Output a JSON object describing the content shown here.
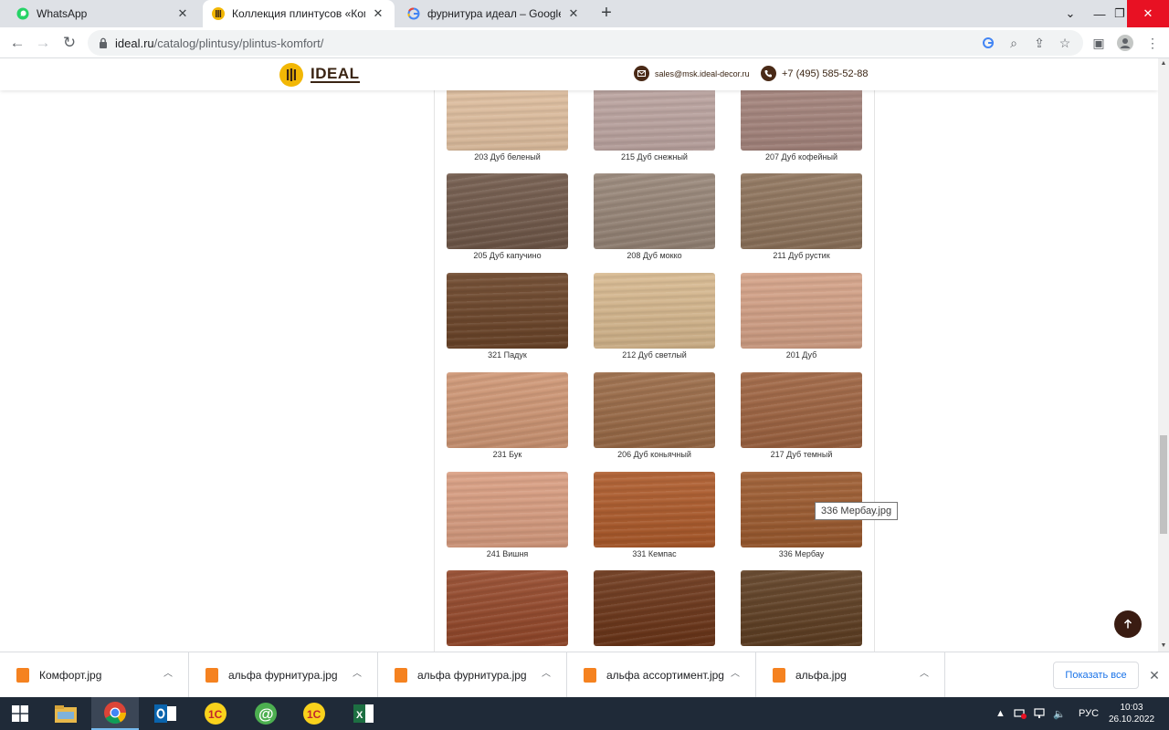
{
  "browser": {
    "tabs": [
      {
        "title": "WhatsApp",
        "icon": "whatsapp-icon",
        "active": false
      },
      {
        "title": "Коллекция плинтусов «Комфорт»",
        "icon": "ideal-logo-icon",
        "active": true
      },
      {
        "title": "фурнитура идеал – Google Поиск",
        "icon": "google-icon",
        "active": false
      }
    ],
    "new_tab_label": "+",
    "url_host": "ideal.ru",
    "url_path": "/catalog/plintusy/plintus-komfort/"
  },
  "site": {
    "brand": "IDEAL",
    "email": "sales@msk.ideal-decor.ru",
    "phone": "+7 (495) 585-52-88"
  },
  "swatches": [
    {
      "label": "203 Дуб беленый",
      "color": "#e4c3a3"
    },
    {
      "label": "215 Дуб снежный",
      "color": "#c0a8a4"
    },
    {
      "label": "207 Дуб кофейный",
      "color": "#a8877f"
    },
    {
      "label": "205 Дуб капучино",
      "color": "#705849"
    },
    {
      "label": "208 Дуб мокко",
      "color": "#978577"
    },
    {
      "label": "211 Дуб рустик",
      "color": "#8e735b"
    },
    {
      "label": "321 Падук",
      "color": "#6b4428"
    },
    {
      "label": "212 Дуб светлый",
      "color": "#d7b88e"
    },
    {
      "label": "201 Дуб",
      "color": "#d4a186"
    },
    {
      "label": "231 Бук",
      "color": "#cf9674"
    },
    {
      "label": "206 Дуб коньячный",
      "color": "#9a6a46"
    },
    {
      "label": "217 Дуб темный",
      "color": "#9e6340"
    },
    {
      "label": "241 Вишня",
      "color": "#d99d80"
    },
    {
      "label": "331 Кемпас",
      "color": "#ad5a2a"
    },
    {
      "label": "336 Мербау",
      "color": "#9c5a2e"
    },
    {
      "label": "",
      "color": "#94482a"
    },
    {
      "label": "",
      "color": "#6b3518"
    },
    {
      "label": "",
      "color": "#5e3e22"
    }
  ],
  "tooltip": "336 Мербау.jpg",
  "downloads": [
    {
      "name": "Комфорт.jpg"
    },
    {
      "name": "альфа фурнитура.jpg"
    },
    {
      "name": "альфа фурнитура.jpg"
    },
    {
      "name": "альфа ассортимент.jpg"
    },
    {
      "name": "альфа.jpg"
    }
  ],
  "shelf": {
    "show_all": "Показать все"
  },
  "taskbar": {
    "lang": "РУС",
    "time": "10:03",
    "date": "26.10.2022"
  }
}
